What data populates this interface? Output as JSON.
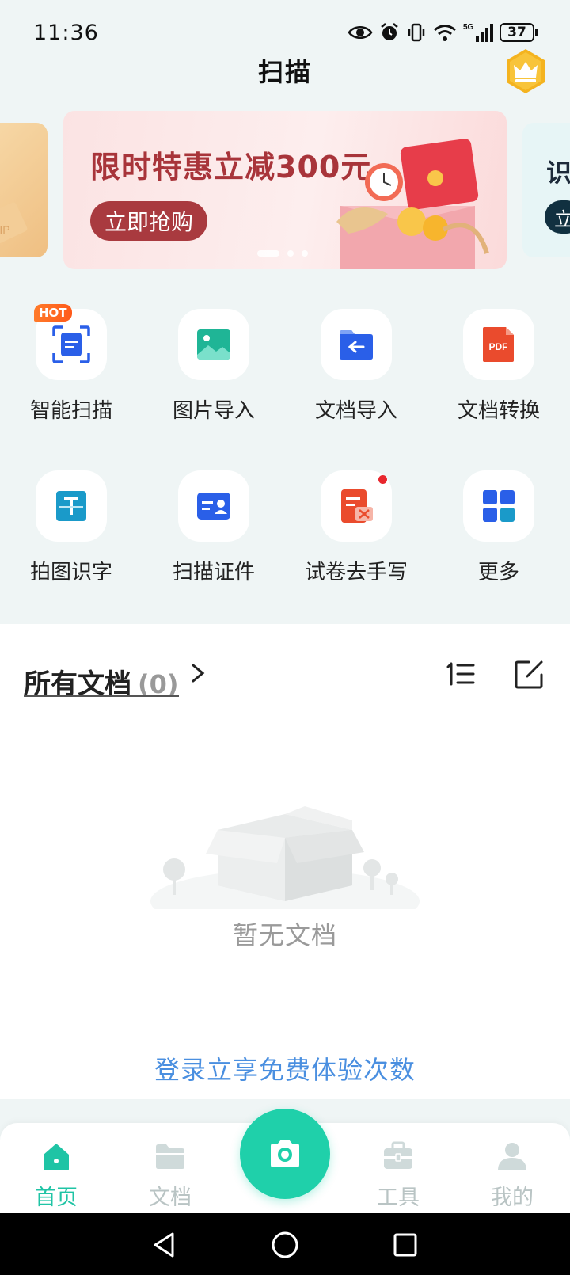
{
  "status_bar": {
    "time": "11:36",
    "network": "5G",
    "battery": "37"
  },
  "header": {
    "title": "扫描"
  },
  "banners": {
    "main": {
      "title": "限时特惠立减300元",
      "button": "立即抢购"
    },
    "right": {
      "title": "识",
      "button": "立"
    },
    "left": {
      "text": "VIP"
    }
  },
  "tools": {
    "hot_badge": "HOT",
    "pdf_label": "PDF",
    "items": [
      {
        "label": "智能扫描"
      },
      {
        "label": "图片导入"
      },
      {
        "label": "文档导入"
      },
      {
        "label": "文档转换"
      },
      {
        "label": "拍图识字"
      },
      {
        "label": "扫描证件"
      },
      {
        "label": "试卷去手写"
      },
      {
        "label": "更多"
      }
    ]
  },
  "documents": {
    "title": "所有文档",
    "count": "(0)",
    "empty_text": "暂无文档",
    "login_link": "登录立享免费体验次数"
  },
  "bottom_nav": {
    "items": [
      {
        "label": "首页"
      },
      {
        "label": "文档"
      },
      {
        "label": "工具"
      },
      {
        "label": "我的"
      }
    ]
  },
  "colors": {
    "accent": "#1fd0aa",
    "banner_red": "#a93a3f",
    "link_blue": "#4a8fe0",
    "page_bg": "#eff5f5"
  }
}
